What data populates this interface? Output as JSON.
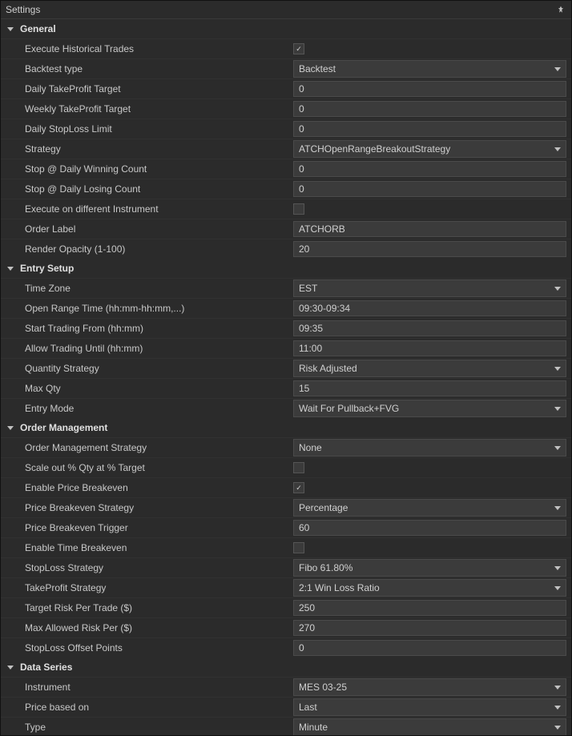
{
  "title": "Settings",
  "sections": {
    "general": {
      "title": "General",
      "executeHistoricalTrades_label": "Execute Historical Trades",
      "executeHistoricalTrades_checked": true,
      "backtestType_label": "Backtest type",
      "backtestType_value": "Backtest",
      "dailyTP_label": "Daily TakeProfit Target",
      "dailyTP_value": "0",
      "weeklyTP_label": "Weekly TakeProfit Target",
      "weeklyTP_value": "0",
      "dailySL_label": "Daily StopLoss Limit",
      "dailySL_value": "0",
      "strategy_label": "Strategy",
      "strategy_value": "ATCHOpenRangeBreakoutStrategy",
      "stopWin_label": "Stop @ Daily Winning Count",
      "stopWin_value": "0",
      "stopLose_label": "Stop @ Daily Losing Count",
      "stopLose_value": "0",
      "execDiff_label": "Execute on different Instrument",
      "execDiff_checked": false,
      "orderLabel_label": "Order Label",
      "orderLabel_value": "ATCHORB",
      "renderOpacity_label": "Render Opacity (1-100)",
      "renderOpacity_value": "20"
    },
    "entrySetup": {
      "title": "Entry Setup",
      "timeZone_label": "Time Zone",
      "timeZone_value": "EST",
      "openRange_label": "Open Range Time (hh:mm-hh:mm,...)",
      "openRange_value": "09:30-09:34",
      "startTrading_label": "Start Trading From (hh:mm)",
      "startTrading_value": "09:35",
      "allowUntil_label": "Allow Trading Until (hh:mm)",
      "allowUntil_value": "11:00",
      "qtyStrategy_label": "Quantity Strategy",
      "qtyStrategy_value": "Risk Adjusted",
      "maxQty_label": "Max Qty",
      "maxQty_value": "15",
      "entryMode_label": "Entry Mode",
      "entryMode_value": "Wait For Pullback+FVG"
    },
    "orderMgmt": {
      "title": "Order Management",
      "omStrategy_label": "Order Management Strategy",
      "omStrategy_value": "None",
      "scaleOut_label": "Scale out % Qty at % Target",
      "scaleOut_checked": false,
      "enablePriceBE_label": "Enable Price Breakeven",
      "enablePriceBE_checked": true,
      "priceBEStrategy_label": "Price Breakeven Strategy",
      "priceBEStrategy_value": "Percentage",
      "priceBETrigger_label": "Price Breakeven Trigger",
      "priceBETrigger_value": "60",
      "enableTimeBE_label": "Enable Time Breakeven",
      "enableTimeBE_checked": false,
      "slStrategy_label": "StopLoss Strategy",
      "slStrategy_value": "Fibo 61.80%",
      "tpStrategy_label": "TakeProfit Strategy",
      "tpStrategy_value": "2:1 Win Loss Ratio",
      "targetRisk_label": "Target Risk Per Trade ($)",
      "targetRisk_value": "250",
      "maxRisk_label": "Max Allowed Risk Per ($)",
      "maxRisk_value": "270",
      "slOffset_label": "StopLoss Offset Points",
      "slOffset_value": "0"
    },
    "dataSeries": {
      "title": "Data Series",
      "instrument_label": "Instrument",
      "instrument_value": "MES 03-25",
      "priceBased_label": "Price based on",
      "priceBased_value": "Last",
      "type_label": "Type",
      "type_value": "Minute"
    }
  }
}
